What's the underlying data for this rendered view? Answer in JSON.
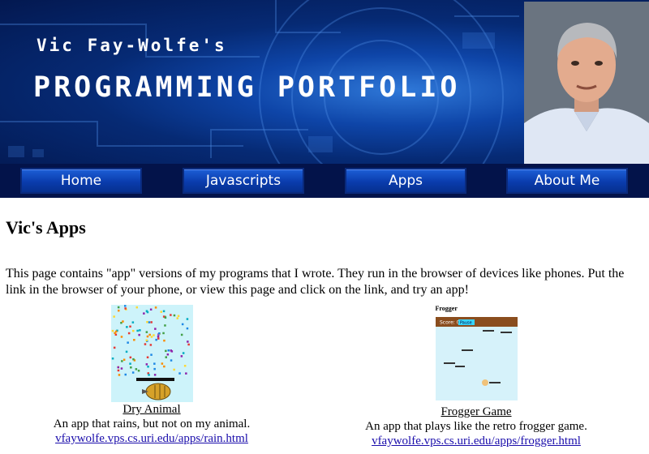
{
  "header": {
    "subtitle": "Vic Fay-Wolfe's",
    "title": "PROGRAMMING PORTFOLIO"
  },
  "nav": {
    "items": [
      {
        "label": "Home"
      },
      {
        "label": "Javascripts"
      },
      {
        "label": "Apps"
      },
      {
        "label": "About Me"
      }
    ]
  },
  "page": {
    "heading": "Vic's Apps",
    "intro": "This page contains \"app\" versions of my programs that I wrote. They run in the browser of devices like phones. Put the link in the browser of your phone, or view this page and click on the link, and try an app!"
  },
  "apps": [
    {
      "name": "Dry Animal",
      "description": "An app that rains, but not on my animal.",
      "url": "vfaywolfe.vps.cs.uri.edu/apps/rain.html"
    },
    {
      "name": "Frogger Game",
      "description": "An app that plays like the retro frogger game.",
      "url": "vfaywolfe.vps.cs.uri.edu/apps/frogger.html",
      "thumb_title": "Frogger",
      "thumb_score": "Score: 0",
      "thumb_button": "Pause"
    }
  ],
  "colors": {
    "banner_dark": "#031850",
    "nav_bar": "#03134a",
    "button_blue": "#0a3cad",
    "link_blue": "#1a0dab"
  }
}
